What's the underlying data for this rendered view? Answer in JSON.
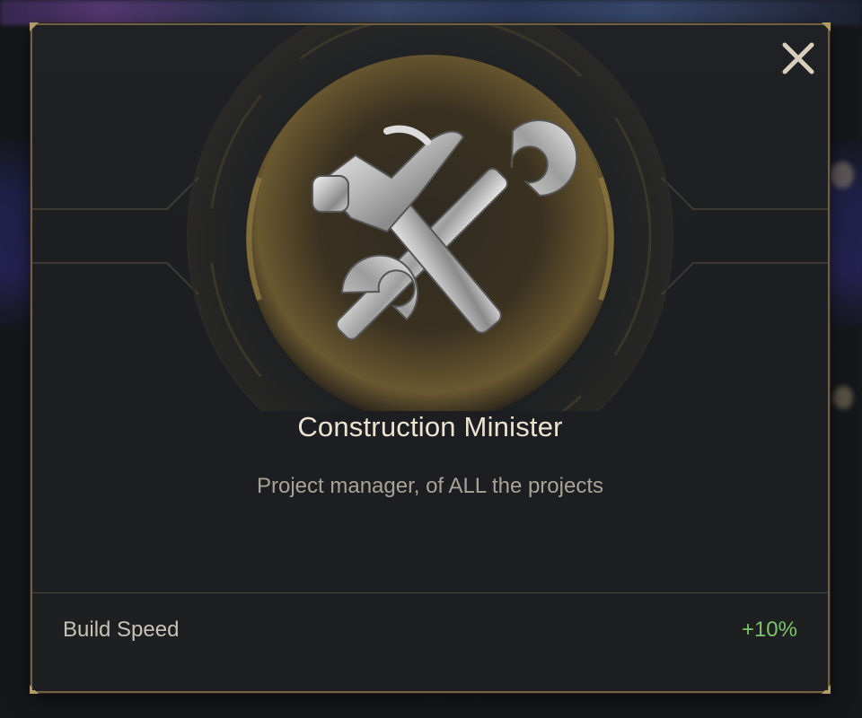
{
  "dialog": {
    "title": "Construction Minister",
    "description": "Project manager, of ALL the projects",
    "emblem_icon": "hammer-wrench-crossed-icon",
    "close_icon": "close-x-icon"
  },
  "stats": [
    {
      "label": "Build Speed",
      "value": "+10%"
    }
  ],
  "colors": {
    "title": "#ece3d0",
    "description": "#a8a396",
    "stat_label": "#c7c2b6",
    "stat_value_positive": "#7cc46a",
    "frame_gold": "#b49a64",
    "panel_bg": "#1f2124"
  }
}
